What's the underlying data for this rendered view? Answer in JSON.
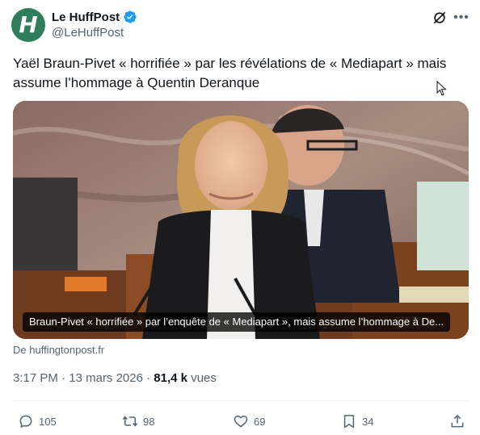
{
  "author": {
    "avatar_letter": "H",
    "name": "Le HuffPost",
    "handle": "@LeHuffPost",
    "verified": true
  },
  "tweet": {
    "text": "Yaël Braun-Pivet « horrifiée » par les révélations de « Mediapart » mais assume l’hommage à Quentin Deranque"
  },
  "card": {
    "caption": "Braun-Pivet « horrifiée » par l’enquête de « Mediapart », mais assume l’hommage à De...",
    "source": "De huffingtonpost.fr"
  },
  "meta": {
    "time": "3:17 PM",
    "date": "13 mars 2026",
    "views_count": "81,4 k",
    "views_label": "vues"
  },
  "actions": {
    "replies": "105",
    "reposts": "98",
    "likes": "69",
    "bookmarks": "34"
  },
  "colors": {
    "accent": "#1d9bf0",
    "avatar_bg": "#2e7d5b",
    "muted": "#536471",
    "text": "#0f1419"
  },
  "icons": [
    "verified-badge-icon",
    "grok-icon",
    "more-icon",
    "reply-icon",
    "repost-icon",
    "like-icon",
    "bookmark-icon",
    "share-icon",
    "cursor-icon"
  ]
}
